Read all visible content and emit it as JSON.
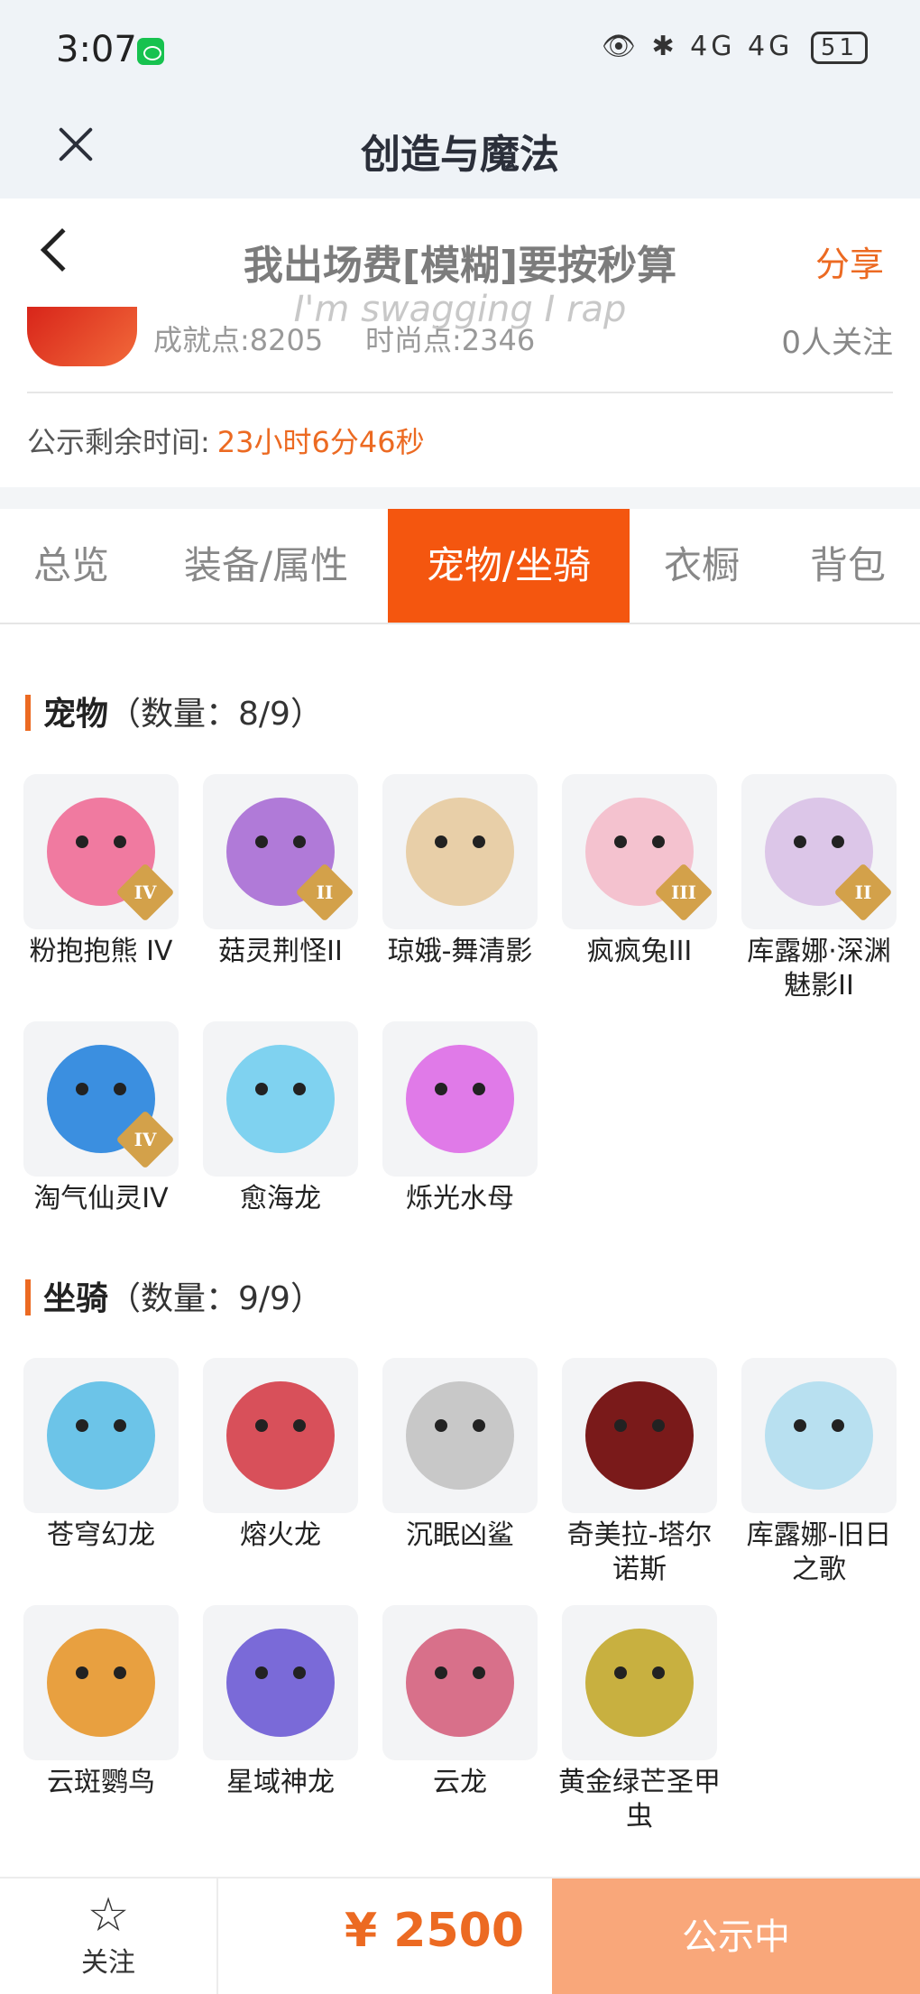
{
  "status_bar": {
    "time": "3:07",
    "network": "4G 4G",
    "battery": "51"
  },
  "app": {
    "title": "创造与魔法"
  },
  "header": {
    "title": "我出场费[模糊]要按秒算",
    "share": "分享",
    "lyric": "I'm swagging I rap"
  },
  "profile": {
    "achievement": "成就点:8205",
    "fashion": "时尚点:2346",
    "followers": "0人关注"
  },
  "publicity": {
    "label": "公示剩余时间:",
    "value": "23小时6分46秒"
  },
  "tabs": [
    {
      "label": "总览",
      "active": false
    },
    {
      "label": "装备/属性",
      "active": false
    },
    {
      "label": "宠物/坐骑",
      "active": true
    },
    {
      "label": "衣橱",
      "active": false
    },
    {
      "label": "背包",
      "active": false
    }
  ],
  "pets": {
    "title": "宠物",
    "count": "（数量：8/9）",
    "items": [
      {
        "name": "粉抱抱熊 IV",
        "tier": "IV",
        "color": "#f07aa0"
      },
      {
        "name": "菇灵荆怪II",
        "tier": "II",
        "color": "#b07ad8"
      },
      {
        "name": "琼娥-舞清影",
        "tier": "",
        "color": "#e8cfa8"
      },
      {
        "name": "疯疯兔III",
        "tier": "III",
        "color": "#f4c2cf"
      },
      {
        "name": "库露娜·深渊魅影II",
        "tier": "II",
        "color": "#dcc6e8"
      },
      {
        "name": "淘气仙灵IV",
        "tier": "IV",
        "color": "#3b8fe0"
      },
      {
        "name": "愈海龙",
        "tier": "",
        "color": "#7fd2f0"
      },
      {
        "name": "烁光水母",
        "tier": "",
        "color": "#e07ae8"
      }
    ]
  },
  "mounts": {
    "title": "坐骑",
    "count": "（数量：9/9）",
    "items": [
      {
        "name": "苍穹幻龙",
        "color": "#6cc4e8"
      },
      {
        "name": "熔火龙",
        "color": "#d8505a"
      },
      {
        "name": "沉眠凶鲨",
        "color": "#c8c8c8"
      },
      {
        "name": "奇美拉-塔尔诺斯",
        "color": "#7a1a1a"
      },
      {
        "name": "库露娜-旧日之歌",
        "color": "#b8e0f0"
      },
      {
        "name": "云斑鹦鸟",
        "color": "#e8a040"
      },
      {
        "name": "星域神龙",
        "color": "#7a6ad8"
      },
      {
        "name": "云龙",
        "color": "#d8708a"
      },
      {
        "name": "黄金绿芒圣甲虫",
        "color": "#c8b040"
      }
    ]
  },
  "bottom": {
    "follow": "关注",
    "price": "¥ 2500",
    "status": "公示中"
  }
}
